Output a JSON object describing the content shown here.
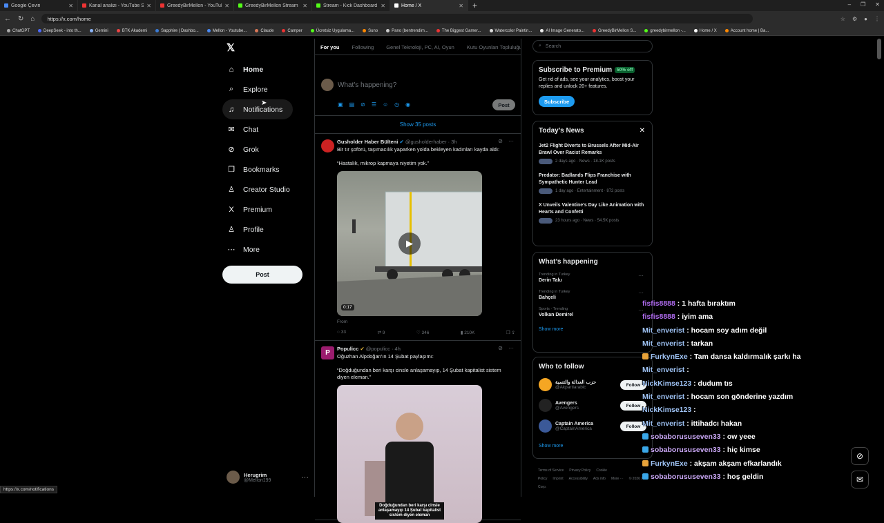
{
  "browser": {
    "tabs": [
      {
        "label": "Google Çeviri",
        "color": "#4a8af4",
        "active": false
      },
      {
        "label": "Kanal analizi - YouTube Studio",
        "color": "#e33",
        "active": false
      },
      {
        "label": "GreedyBirMellon - YouTube",
        "color": "#e33",
        "active": false
      },
      {
        "label": "GreedyBirMellon Stream - Watch L",
        "color": "#53fc18",
        "active": false
      },
      {
        "label": "Stream - Kick Dashboard",
        "color": "#53fc18",
        "active": false
      },
      {
        "label": "Home / X",
        "color": "#fff",
        "active": true
      }
    ],
    "url": "https://x.com/home",
    "bookmarks": [
      {
        "label": "ChatGPT",
        "color": "#aaa"
      },
      {
        "label": "DeepSeek - into th...",
        "color": "#4d6bfe"
      },
      {
        "label": "Gemini",
        "color": "#8ab4f8"
      },
      {
        "label": "BTK Akademi",
        "color": "#e44"
      },
      {
        "label": "Sapphire | Dashbo...",
        "color": "#3a7bd5"
      },
      {
        "label": "Mellon - Youtube...",
        "color": "#4a8af4"
      },
      {
        "label": "Claude",
        "color": "#d97757"
      },
      {
        "label": "Camper",
        "color": "#e33"
      },
      {
        "label": "Ücretsiz Uygulama...",
        "color": "#53fc18"
      },
      {
        "label": "Suno",
        "color": "#f80"
      },
      {
        "label": "Pano (bentrendim...",
        "color": "#ccc"
      },
      {
        "label": "The Biggest Gamer...",
        "color": "#e33"
      },
      {
        "label": "Watercolor Paintin...",
        "color": "#ddd"
      },
      {
        "label": "AI Image Generato...",
        "color": "#eee"
      },
      {
        "label": "GreedyBirMellon S...",
        "color": "#e33"
      },
      {
        "label": "greedybirmellon -...",
        "color": "#53fc18"
      },
      {
        "label": "Home / X",
        "color": "#fff"
      },
      {
        "label": "Account home | Ba...",
        "color": "#f80"
      }
    ]
  },
  "nav": {
    "items": [
      {
        "label": "Home",
        "icon": "⌂",
        "name": "home"
      },
      {
        "label": "Explore",
        "icon": "⌕",
        "name": "explore"
      },
      {
        "label": "Notifications",
        "icon": "♫",
        "name": "notifications"
      },
      {
        "label": "Chat",
        "icon": "✉",
        "name": "chat"
      },
      {
        "label": "Grok",
        "icon": "⊘",
        "name": "grok"
      },
      {
        "label": "Bookmarks",
        "icon": "❒",
        "name": "bookmarks"
      },
      {
        "label": "Creator Studio",
        "icon": "♙",
        "name": "creator-studio"
      },
      {
        "label": "Premium",
        "icon": "X",
        "name": "premium"
      },
      {
        "label": "Profile",
        "icon": "♙",
        "name": "profile"
      },
      {
        "label": "More",
        "icon": "⋯",
        "name": "more"
      }
    ],
    "post_label": "Post",
    "user_name": "Herugrim",
    "user_handle": "@Mellon199"
  },
  "timeline": {
    "tabs": [
      "For you",
      "Following",
      "Genel Teknoloji, PC, AI, Oyun",
      "Kutu Oyunları Topluluğu"
    ],
    "compose_placeholder": "What's happening?",
    "compose_post": "Post",
    "show_posts": "Show 35 posts",
    "tweet1": {
      "name": "Gusholder Haber Bülteni",
      "meta": "@gusholderhaber · 3h",
      "text1": "Bir tır şoförü, taşımacılık yaparken yolda bekleyen kadınları kayda aldı:",
      "text2": "“Hastalık, mikrop kapmaya niyetim yok.”",
      "duration": "0:17",
      "from": "From",
      "replies": "33",
      "reposts": "9",
      "likes": "346",
      "views": "210K"
    },
    "tweet2": {
      "name": "Populicc",
      "meta": "@populicc · 4h",
      "text1": "Oğuzhan Alpdoğan'ın 14 Şubat paylaşımı:",
      "text2": "“Doğduğundan beri karşı cinsle anlaşamayıp, 14 Şubat kapitalist sistem diyen eleman.”",
      "caption": "Doğduğundan beri karşı cinsle anlaşamayıp 14 Şubat kapitalist sistem diyen eleman"
    }
  },
  "right": {
    "search_placeholder": "Search",
    "premium": {
      "title": "Subscribe to Premium",
      "badge": "50% off",
      "text": "Get rid of ads, see your analytics, boost your replies and unlock 20+ features.",
      "button": "Subscribe"
    },
    "news": {
      "title": "Today’s News",
      "items": [
        {
          "title": "Jet2 Flight Diverts to Brussels After Mid-Air Brawl Over Racist Remarks",
          "meta": "2 days ago · News · 18.1K posts"
        },
        {
          "title": "Predator: Badlands Flips Franchise with Sympathetic Hunter Lead",
          "meta": "1 day ago · Entertainment · 872 posts"
        },
        {
          "title": "X Unveils Valentine's Day Like Animation with Hearts and Confetti",
          "meta": "23 hours ago · News · 54.5K posts"
        }
      ]
    },
    "happening": {
      "title": "What’s happening",
      "trends": [
        {
          "context": "Trending in Turkey",
          "name": "Derin Talu"
        },
        {
          "context": "Trending in Turkey",
          "name": "Bahçeli"
        },
        {
          "context": "Sports · Trending",
          "name": "Volkan Demirel"
        }
      ],
      "show_more": "Show more"
    },
    "follow": {
      "title": "Who to follow",
      "accounts": [
        {
          "name": "حزب العدالة والتنمية",
          "handle": "@Akpartiarabic",
          "color": "#f5a623"
        },
        {
          "name": "Avengers",
          "handle": "@Avengers",
          "color": "#222"
        },
        {
          "name": "Captain America",
          "handle": "@CaptainAmerica",
          "color": "#3b5998"
        }
      ],
      "follow_label": "Follow",
      "show_more": "Show more"
    },
    "footer": [
      "Terms of Service",
      "Privacy Policy",
      "Cookie Policy",
      "Imprint",
      "Accessibility",
      "Ads info",
      "More ···",
      "© 2026 X Corp."
    ]
  },
  "chat": [
    {
      "user": "fisfis8888",
      "msg": " : 1 hafta bıraktım",
      "color": "#b06cf0",
      "badge": ""
    },
    {
      "user": "fisfis8888",
      "msg": " : iyim ama",
      "color": "#b06cf0",
      "badge": ""
    },
    {
      "user": "Mit_enverist",
      "msg": " : hocam soy adım değil",
      "color": "#9fc3f5",
      "badge": ""
    },
    {
      "user": "Mit_enverist",
      "msg": " : tarkan",
      "color": "#9fc3f5",
      "badge": ""
    },
    {
      "user": "FurkynExe",
      "msg": " : Tam dansa kaldırmalık şarkı ha",
      "color": "#9fc3f5",
      "badge": "#e8a33a"
    },
    {
      "user": "Mit_enverist",
      "msg": " : ",
      "color": "#9fc3f5",
      "badge": ""
    },
    {
      "user": "NickKimse123",
      "msg": " : dudum tıs",
      "color": "#9fc3f5",
      "badge": ""
    },
    {
      "user": "Mit_enverist",
      "msg": " : hocam son gönderine yazdım",
      "color": "#9fc3f5",
      "badge": ""
    },
    {
      "user": "NickKimse123",
      "msg": " : ",
      "color": "#9fc3f5",
      "badge": ""
    },
    {
      "user": "Mit_enverist",
      "msg": " : ittihadcı hakan",
      "color": "#9fc3f5",
      "badge": ""
    },
    {
      "user": "sobaborususeven33",
      "msg": " : ow yeee",
      "color": "#c9a7f5",
      "badge": "#3aa7e8"
    },
    {
      "user": "sobaborususeven33",
      "msg": " : hiç kimse",
      "color": "#c9a7f5",
      "badge": "#3aa7e8"
    },
    {
      "user": "FurkynExe",
      "msg": " : akşam akşam efkarlandık",
      "color": "#9fc3f5",
      "badge": "#e8a33a"
    },
    {
      "user": "sobaborususeven33",
      "msg": " : hoş geldin",
      "color": "#c9a7f5",
      "badge": "#3aa7e8"
    }
  ],
  "status_url": "https://x.com/notifications"
}
